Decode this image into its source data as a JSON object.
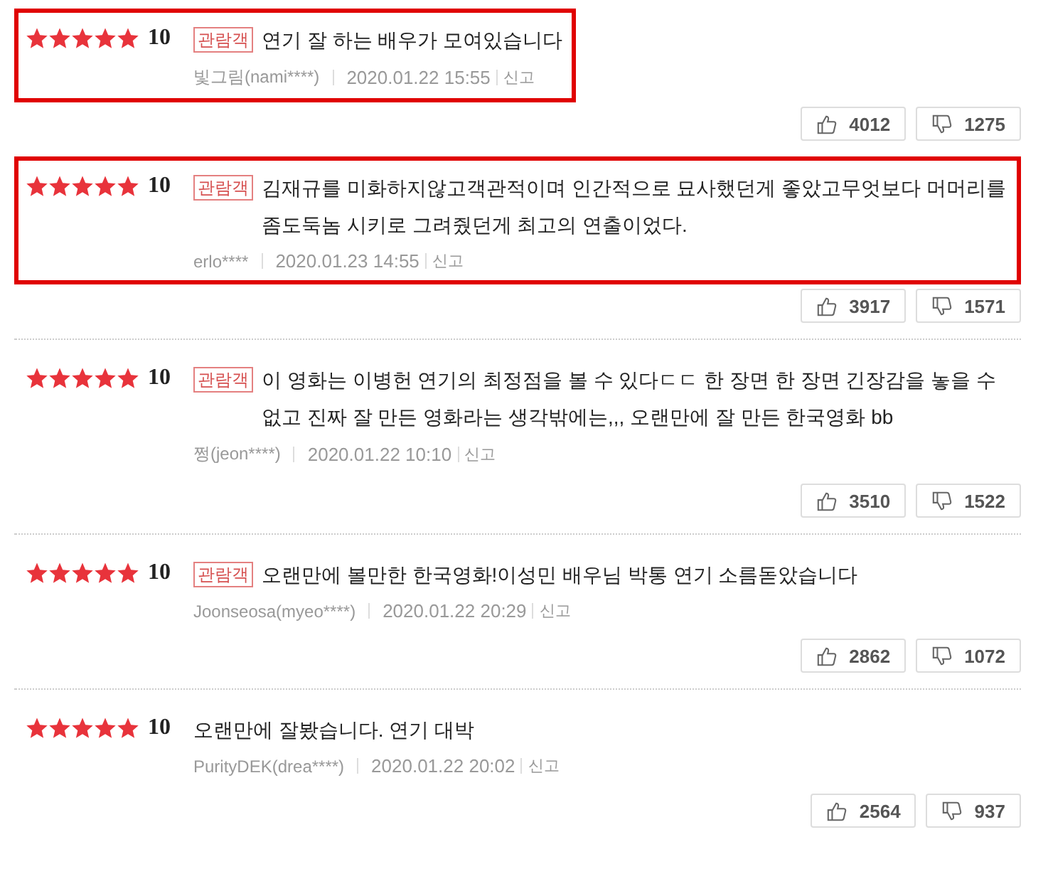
{
  "reviews": [
    {
      "stars": 5,
      "score": "10",
      "badge": "관람객",
      "text": "연기 잘 하는 배우가 모여있습니다",
      "author": "빛그림(nami****)",
      "date": "2020.01.22 15:55",
      "report": "신고",
      "likes": "4012",
      "dislikes": "1275",
      "highlighted": true
    },
    {
      "stars": 5,
      "score": "10",
      "badge": "관람객",
      "text": "김재규를 미화하지않고객관적이며 인간적으로 묘사했던게 좋았고무엇보다 머머리를 좀도둑놈 시키로 그려줬던게 최고의 연출이었다.",
      "author": "erlo****",
      "date": "2020.01.23 14:55",
      "report": "신고",
      "likes": "3917",
      "dislikes": "1571",
      "highlighted": true
    },
    {
      "stars": 5,
      "score": "10",
      "badge": "관람객",
      "text": "이 영화는 이병헌 연기의 최정점을 볼 수 있다ㄷㄷ 한 장면 한 장면 긴장감을 놓을 수 없고 진짜 잘 만든 영화라는 생각밖에는,,, 오랜만에 잘 만든 한국영화 bb",
      "author": "쩡(jeon****)",
      "date": "2020.01.22 10:10",
      "report": "신고",
      "likes": "3510",
      "dislikes": "1522",
      "highlighted": false
    },
    {
      "stars": 5,
      "score": "10",
      "badge": "관람객",
      "text": "오랜만에 볼만한 한국영화!이성민 배우님 박통 연기 소름돋았습니다",
      "author": "Joonseosa(myeo****)",
      "date": "2020.01.22 20:29",
      "report": "신고",
      "likes": "2862",
      "dislikes": "1072",
      "highlighted": false
    },
    {
      "stars": 5,
      "score": "10",
      "text": "오랜만에 잘봤습니다. 연기 대박",
      "author": "PurityDEK(drea****)",
      "date": "2020.01.22 20:02",
      "report": "신고",
      "likes": "2564",
      "dislikes": "937",
      "highlighted": false
    }
  ]
}
